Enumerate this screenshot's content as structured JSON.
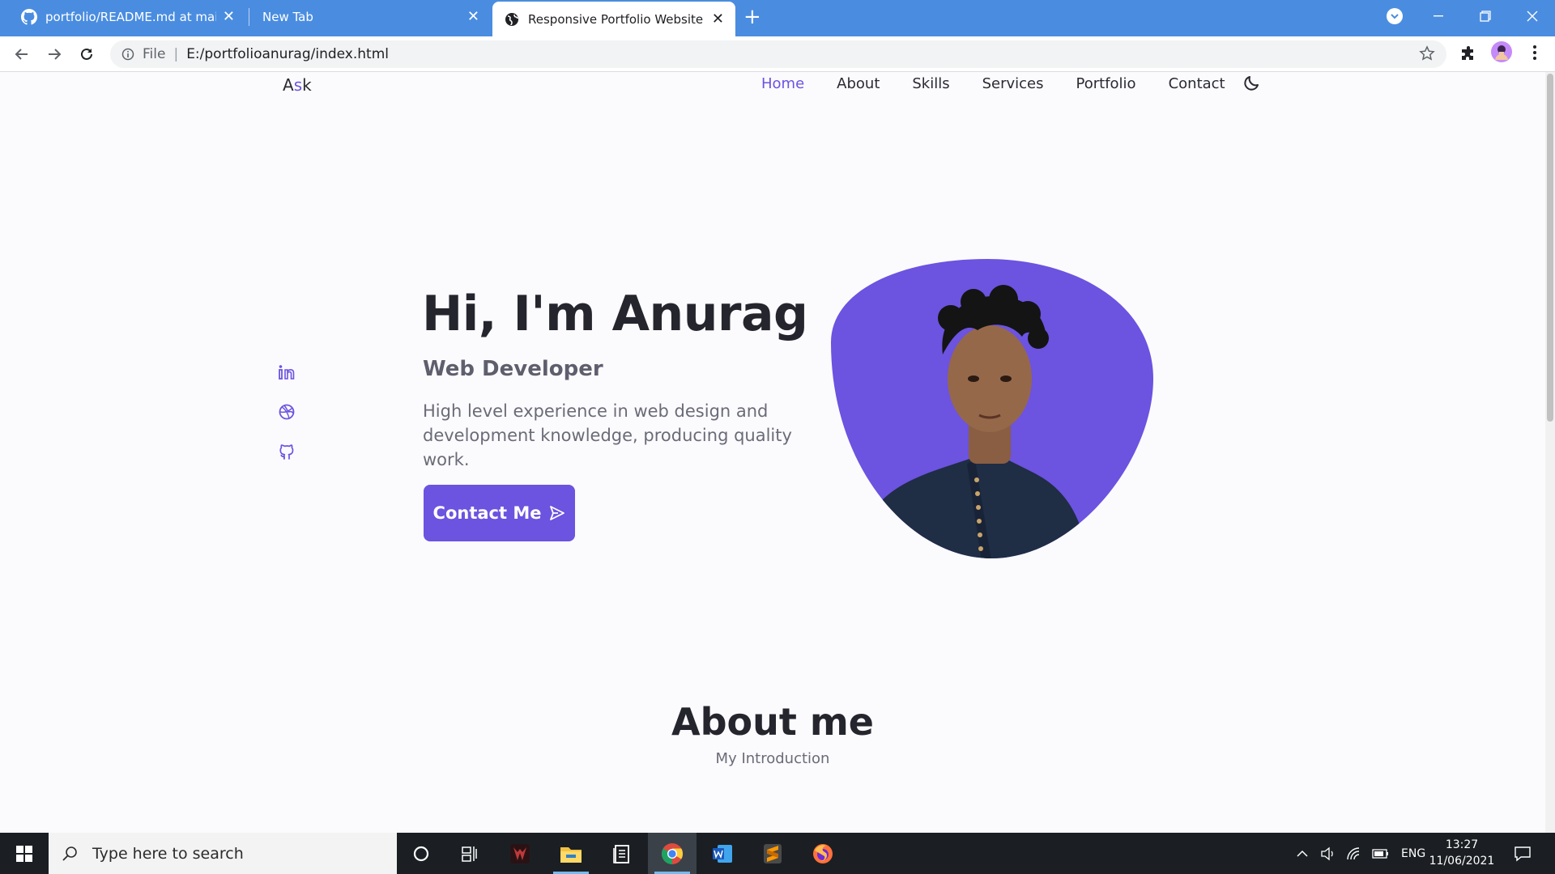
{
  "browser": {
    "tabs": [
      {
        "title": "portfolio/README.md at main · /",
        "favicon": "github-icon"
      },
      {
        "title": "New Tab",
        "favicon": ""
      },
      {
        "title": "Responsive Portfolio Website",
        "favicon": "globe-icon"
      }
    ],
    "address": {
      "scheme_label": "File",
      "url": "E:/portfolioanurag/index.html"
    }
  },
  "site": {
    "logo_main": "A",
    "logo_accent": "s",
    "logo_end": "k",
    "nav": [
      "Home",
      "About",
      "Skills",
      "Services",
      "Portfolio",
      "Contact"
    ],
    "active_nav": "Home",
    "hero": {
      "title": "Hi, I'm Anurag",
      "subtitle": "Web Developer",
      "description": "High level experience in web design and development knowledge, producing quality work.",
      "cta_label": "Contact Me"
    },
    "social": [
      "linkedin-icon",
      "dribbble-icon",
      "github-icon"
    ],
    "about": {
      "title": "About me",
      "subtitle": "My Introduction"
    }
  },
  "taskbar": {
    "search_placeholder": "Type here to search",
    "apps": [
      "cortana-icon",
      "task-view-icon",
      "predator-icon",
      "file-explorer-icon",
      "notes-icon",
      "chrome-icon",
      "word-icon",
      "sublime-icon",
      "firefox-icon"
    ],
    "language": "ENG",
    "time": "13:27",
    "date": "11/06/2021"
  },
  "colors": {
    "accent": "#6c53e0",
    "tabstrip": "#4a8de0",
    "taskbar": "#1b1f23"
  }
}
